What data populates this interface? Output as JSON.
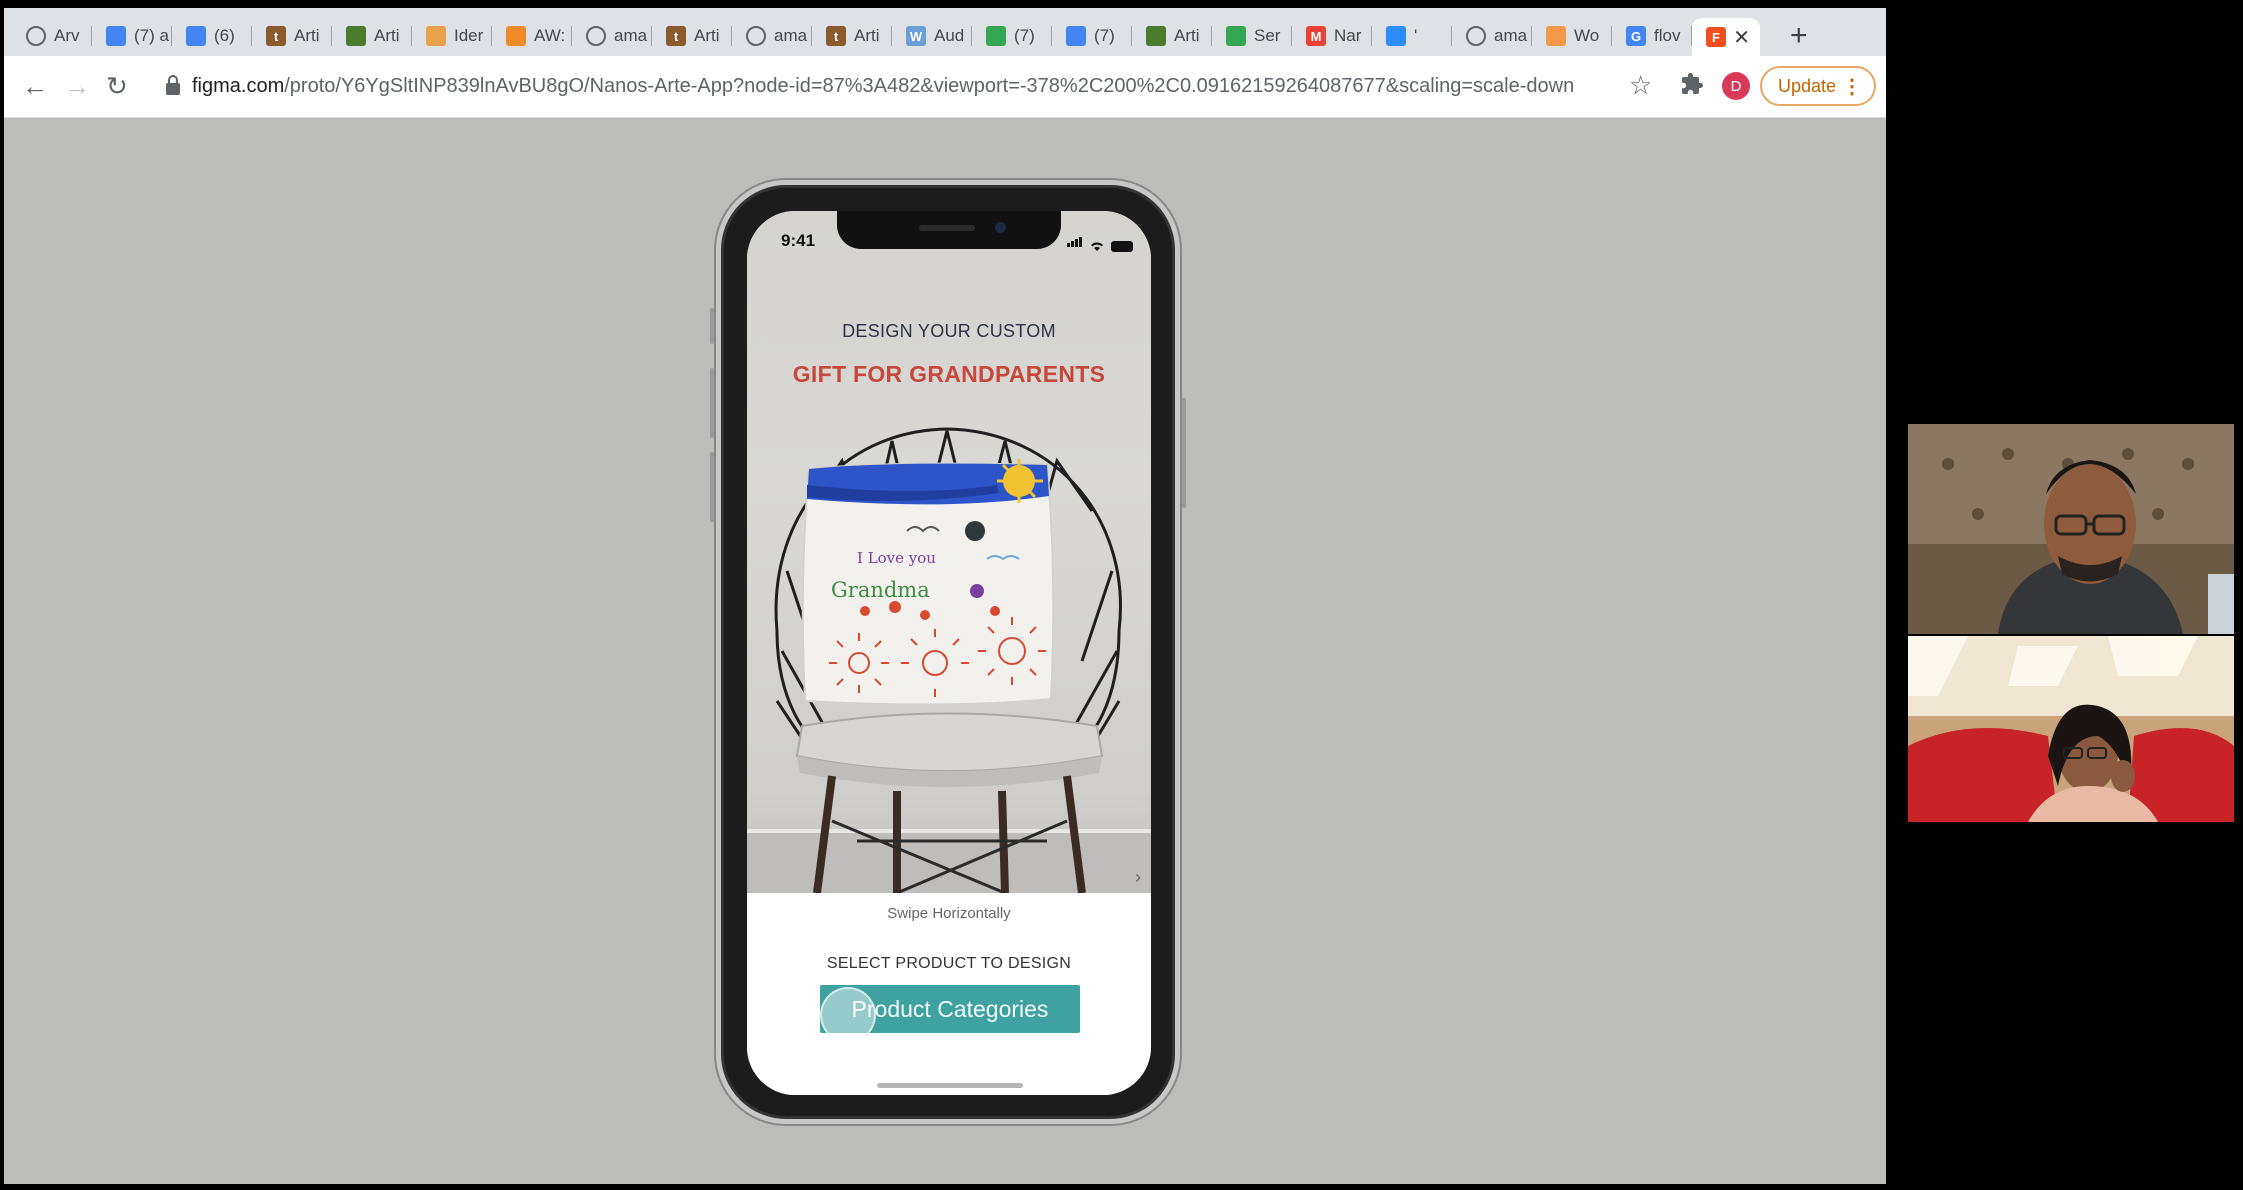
{
  "browser": {
    "tabs": [
      {
        "label": "Arv",
        "icon": "box-icon",
        "color": "#5f6368"
      },
      {
        "label": "(7) a",
        "icon": "doc-icon",
        "color": "#4285f4"
      },
      {
        "label": "(6)",
        "icon": "doc-icon",
        "color": "#4285f4"
      },
      {
        "label": "Arti",
        "icon": "t-icon",
        "color": "#8a5a2b"
      },
      {
        "label": "Arti",
        "icon": "plant-icon",
        "color": "#4b7a2b"
      },
      {
        "label": "Ider",
        "icon": "cube-icon",
        "color": "#e8a34a"
      },
      {
        "label": "AW:",
        "icon": "aws-icon",
        "color": "#f08b2a"
      },
      {
        "label": "ama",
        "icon": "globe-icon",
        "color": "#5f6368"
      },
      {
        "label": "Arti",
        "icon": "t-icon",
        "color": "#8a5a2b"
      },
      {
        "label": "ama",
        "icon": "globe-icon",
        "color": "#5f6368"
      },
      {
        "label": "Arti",
        "icon": "t-icon",
        "color": "#8a5a2b"
      },
      {
        "label": "Aud",
        "icon": "w-icon",
        "color": "#6aa0d8"
      },
      {
        "label": "(7)",
        "icon": "sheet-icon",
        "color": "#34a853"
      },
      {
        "label": "(7)",
        "icon": "doc-icon",
        "color": "#4285f4"
      },
      {
        "label": "Arti",
        "icon": "plant-icon",
        "color": "#4b7a2b"
      },
      {
        "label": "Ser",
        "icon": "sheet-icon",
        "color": "#34a853"
      },
      {
        "label": "Nar",
        "icon": "gmail-icon",
        "color": "#ea4335"
      },
      {
        "label": "'",
        "icon": "zoom-icon",
        "color": "#2d8cff"
      },
      {
        "label": "ama",
        "icon": "globe-icon",
        "color": "#5f6368"
      },
      {
        "label": "Wo",
        "icon": "paperplane-icon",
        "color": "#f2994a"
      },
      {
        "label": "flov",
        "icon": "google-icon",
        "color": "#4285f4"
      },
      {
        "label": "",
        "icon": "figma-icon",
        "color": "#f24e1e",
        "active": true
      }
    ],
    "url_host": "figma.com",
    "url_path": "/proto/Y6YgSltINP839lnAvBU8gO/Nanos-Arte-App?node-id=87%3A482&viewport=-378%2C200%2C0.09162159264087677&scaling=scale-down",
    "avatar_letter": "D",
    "update_label": "Update",
    "update_menu": "⋮",
    "back_glyph": "←",
    "forward_glyph": "→",
    "reload_glyph": "↻",
    "star_glyph": "☆",
    "newtab_glyph": "+",
    "close_glyph": "✕"
  },
  "phone": {
    "time": "9:41",
    "heading_line1": "DESIGN YOUR CUSTOM",
    "heading_line2": "GIFT FOR GRANDPARENTS",
    "pillow_text_1": "I  Love  you",
    "pillow_text_2": "Grandma",
    "swipe_hint": "Swipe Horizontally",
    "select_label": "SELECT PRODUCT TO DESIGN",
    "cta_label": "Product Categories",
    "chevron": "›"
  },
  "colors": {
    "accent_teal": "#3fa2a0",
    "heading_red": "#c8473a",
    "update_orange": "#c26401"
  }
}
